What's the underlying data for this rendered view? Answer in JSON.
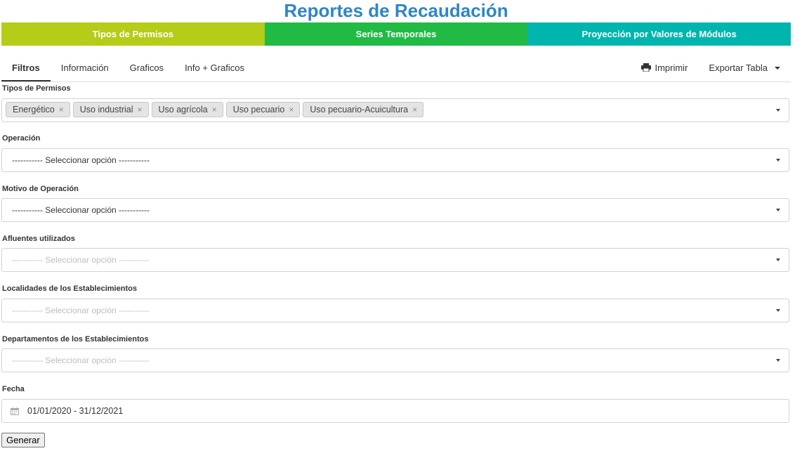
{
  "page": {
    "title": "Reportes de Recaudación"
  },
  "topnav": [
    {
      "label": "Tipos de Permisos",
      "color": "#b5cc18"
    },
    {
      "label": "Series Temporales",
      "color": "#21ba45"
    },
    {
      "label": "Proyección por Valores de Módulos",
      "color": "#00b5ad"
    }
  ],
  "tabs": {
    "filtros": "Filtros",
    "informacion": "Información",
    "graficos": "Graficos",
    "info_graficos": "Info + Graficos",
    "imprimir": "Imprimir",
    "exportar": "Exportar Tabla"
  },
  "filters": {
    "tipos": {
      "label": "Tipos de Permisos",
      "chips": [
        "Energético",
        "Uso industrial",
        "Uso agrícola",
        "Uso pecuario",
        "Uso pecuario-Acuicultura"
      ]
    },
    "operacion": {
      "label": "Operación",
      "value": "----------- Seleccionar opción -----------"
    },
    "motivo": {
      "label": "Motivo de Operación",
      "value": "----------- Seleccionar opción -----------"
    },
    "afluentes": {
      "label": "Afluentes utilizados",
      "placeholder": "----------- Seleccionar opción -----------"
    },
    "localidades": {
      "label": "Localidades de los Establecimientos",
      "placeholder": "----------- Seleccionar opción -----------"
    },
    "departamentos": {
      "label": "Departamentos de los Establecimientos",
      "placeholder": "----------- Seleccionar opción -----------"
    },
    "fecha": {
      "label": "Fecha",
      "value": "01/01/2020 - 31/12/2021"
    }
  },
  "actions": {
    "generar": "Generar"
  },
  "chip_remove": "×"
}
